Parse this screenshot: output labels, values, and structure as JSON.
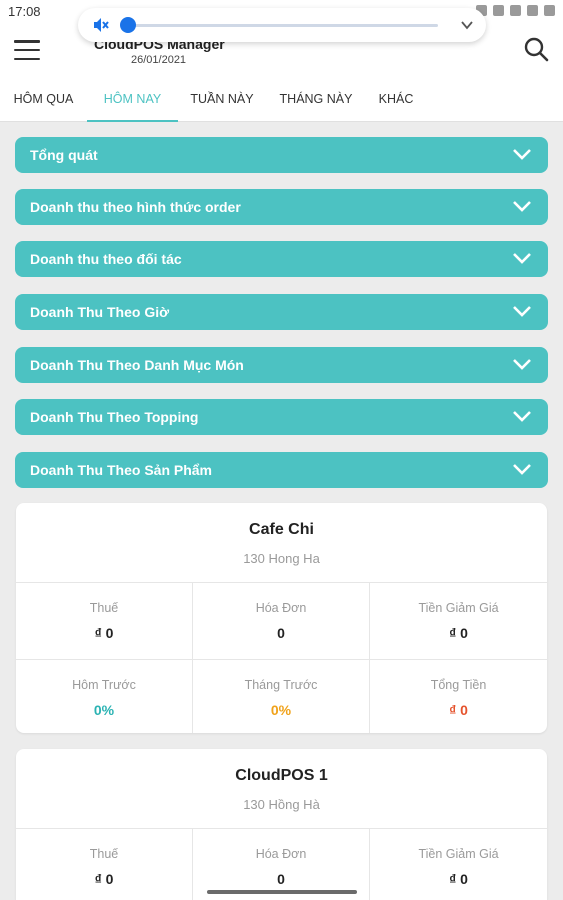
{
  "status": {
    "time": "17:08"
  },
  "header": {
    "title": "CloudPOS Manager",
    "date": "26/01/2021"
  },
  "tabs": [
    {
      "label": "HÔM QUA",
      "active": false
    },
    {
      "label": "HÔM NAY",
      "active": true
    },
    {
      "label": "TUẦN NÀY",
      "active": false
    },
    {
      "label": "THÁNG NÀY",
      "active": false
    },
    {
      "label": "KHÁC",
      "active": false
    }
  ],
  "sections": [
    {
      "label": "Tổng quát"
    },
    {
      "label": "Doanh thu theo hình thức order"
    },
    {
      "label": "Doanh thu theo đối tác"
    },
    {
      "label": "Doanh Thu Theo Giờ"
    },
    {
      "label": "Doanh Thu Theo Danh Mục Món"
    },
    {
      "label": "Doanh Thu Theo Topping"
    },
    {
      "label": "Doanh Thu Theo Sản Phẩm"
    }
  ],
  "stores": [
    {
      "name": "Cafe Chi",
      "address": "130 Hong Ha",
      "stats": [
        {
          "label": "Thuế",
          "value": "₫ 0"
        },
        {
          "label": "Hóa Đơn",
          "value": "0"
        },
        {
          "label": "Tiền Giảm Giá",
          "value": "₫ 0"
        },
        {
          "label": "Hôm Trước",
          "value": "0%"
        },
        {
          "label": "Tháng Trước",
          "value": "0%"
        },
        {
          "label": "Tổng Tiền",
          "value": "₫ 0"
        }
      ]
    },
    {
      "name": "CloudPOS 1",
      "address": "130 Hồng Hà",
      "stats": [
        {
          "label": "Thuế",
          "value": "₫ 0"
        },
        {
          "label": "Hóa Đơn",
          "value": "0"
        },
        {
          "label": "Tiền Giảm Giá",
          "value": "₫ 0"
        }
      ]
    }
  ],
  "colors": {
    "accent": "#4cc2c2",
    "orange": "#f0a21a",
    "red": "#e5532d",
    "volume": "#1a73e8"
  },
  "icons": {
    "menu": "hamburger-icon",
    "search": "search-icon",
    "volume": "volume-mute-icon",
    "chevron": "chevron-down-icon"
  }
}
